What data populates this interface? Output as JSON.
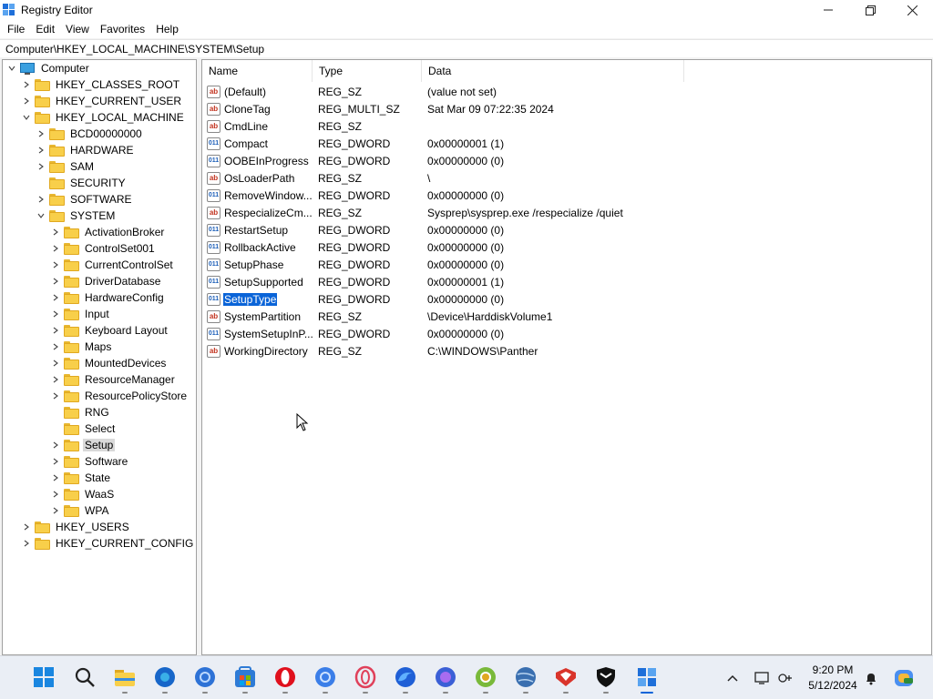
{
  "window": {
    "title": "Registry Editor",
    "minimize": "—",
    "maximize": "❐",
    "close": "✕"
  },
  "menu": [
    "File",
    "Edit",
    "View",
    "Favorites",
    "Help"
  ],
  "address": "Computer\\HKEY_LOCAL_MACHINE\\SYSTEM\\Setup",
  "tree": {
    "root": "Computer",
    "hives": {
      "classes_root": "HKEY_CLASSES_ROOT",
      "current_user": "HKEY_CURRENT_USER",
      "local_machine": "HKEY_LOCAL_MACHINE",
      "users": "HKEY_USERS",
      "current_config": "HKEY_CURRENT_CONFIG"
    },
    "hklm_children": [
      "BCD00000000",
      "HARDWARE",
      "SAM",
      "SECURITY",
      "SOFTWARE",
      "SYSTEM"
    ],
    "system_children": [
      "ActivationBroker",
      "ControlSet001",
      "CurrentControlSet",
      "DriverDatabase",
      "HardwareConfig",
      "Input",
      "Keyboard Layout",
      "Maps",
      "MountedDevices",
      "ResourceManager",
      "ResourcePolicyStore",
      "RNG",
      "Select",
      "Setup",
      "Software",
      "State",
      "WaaS",
      "WPA"
    ],
    "selected": "Setup"
  },
  "list": {
    "columns": [
      "Name",
      "Type",
      "Data"
    ],
    "rows": [
      {
        "name": "(Default)",
        "type": "REG_SZ",
        "data": "(value not set)",
        "icon": "string-value-icon"
      },
      {
        "name": "CloneTag",
        "type": "REG_MULTI_SZ",
        "data": "Sat Mar 09 07:22:35 2024",
        "icon": "string-value-icon"
      },
      {
        "name": "CmdLine",
        "type": "REG_SZ",
        "data": "",
        "icon": "string-value-icon"
      },
      {
        "name": "Compact",
        "type": "REG_DWORD",
        "data": "0x00000001 (1)",
        "icon": "binary-value-icon"
      },
      {
        "name": "OOBEInProgress",
        "type": "REG_DWORD",
        "data": "0x00000000 (0)",
        "icon": "binary-value-icon"
      },
      {
        "name": "OsLoaderPath",
        "type": "REG_SZ",
        "data": "\\",
        "icon": "string-value-icon"
      },
      {
        "name": "RemoveWindow...",
        "type": "REG_DWORD",
        "data": "0x00000000 (0)",
        "icon": "binary-value-icon"
      },
      {
        "name": "RespecializeCm...",
        "type": "REG_SZ",
        "data": "Sysprep\\sysprep.exe /respecialize /quiet",
        "icon": "string-value-icon"
      },
      {
        "name": "RestartSetup",
        "type": "REG_DWORD",
        "data": "0x00000000 (0)",
        "icon": "binary-value-icon"
      },
      {
        "name": "RollbackActive",
        "type": "REG_DWORD",
        "data": "0x00000000 (0)",
        "icon": "binary-value-icon"
      },
      {
        "name": "SetupPhase",
        "type": "REG_DWORD",
        "data": "0x00000000 (0)",
        "icon": "binary-value-icon"
      },
      {
        "name": "SetupSupported",
        "type": "REG_DWORD",
        "data": "0x00000001 (1)",
        "icon": "binary-value-icon"
      },
      {
        "name": "SetupType",
        "type": "REG_DWORD",
        "data": "0x00000000 (0)",
        "icon": "binary-value-icon",
        "selected": true
      },
      {
        "name": "SystemPartition",
        "type": "REG_SZ",
        "data": "\\Device\\HarddiskVolume1",
        "icon": "string-value-icon"
      },
      {
        "name": "SystemSetupInP...",
        "type": "REG_DWORD",
        "data": "0x00000000 (0)",
        "icon": "binary-value-icon"
      },
      {
        "name": "WorkingDirectory",
        "type": "REG_SZ",
        "data": "C:\\WINDOWS\\Panther",
        "icon": "string-value-icon"
      }
    ]
  },
  "taskbar": {
    "time": "9:20 PM",
    "date": "5/12/2024",
    "apps": [
      "start-icon",
      "search-icon",
      "file-explorer-icon",
      "edge-icon",
      "chrome-icon",
      "store-icon",
      "opera-icon",
      "chrome-beta-icon",
      "opera-gx-icon",
      "firefox-icon",
      "firefox-dev-icon",
      "chrome-canary-icon",
      "globe-icon",
      "security-app-icon",
      "shield-app-icon",
      "registry-editor-icon"
    ]
  }
}
